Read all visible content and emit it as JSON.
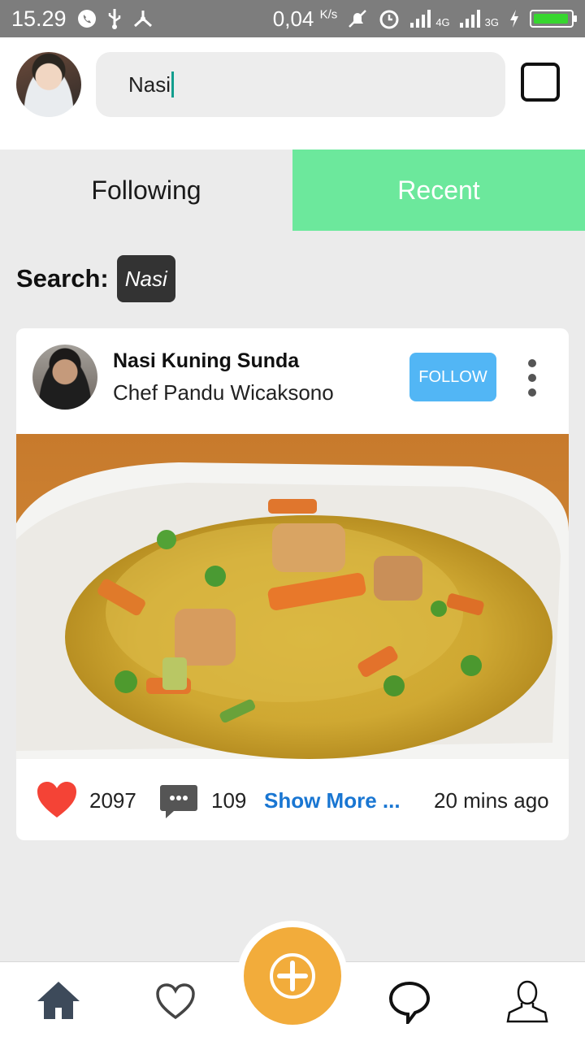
{
  "status_bar": {
    "time": "15.29",
    "speed": "0,04",
    "speed_unit": "K/s",
    "net1": "4G",
    "net2": "3G"
  },
  "header": {
    "search_value": "Nasi"
  },
  "tabs": [
    {
      "label": "Following",
      "active": false
    },
    {
      "label": "Recent",
      "active": true
    }
  ],
  "search": {
    "label": "Search:",
    "query_chip": "Nasi"
  },
  "post": {
    "title": "Nasi Kuning Sunda",
    "author": "Chef Pandu Wicaksono",
    "follow_label": "FOLLOW",
    "likes": "2097",
    "comments": "109",
    "show_more": "Show More ...",
    "time_ago": "20 mins ago"
  },
  "colors": {
    "accent_green": "#6ce89c",
    "follow_blue": "#52b6f5",
    "fab_orange": "#f2ac3b",
    "heart_red": "#f44336",
    "link_blue": "#1976d2"
  },
  "icons": [
    "whatsapp-icon",
    "usb-icon",
    "share-icon",
    "mute-icon",
    "alarm-icon",
    "signal-icon",
    "battery-icon",
    "search-input",
    "heart-icon",
    "comment-icon",
    "home-icon",
    "heart-outline-icon",
    "plus-icon",
    "chat-icon",
    "user-icon",
    "more-icon"
  ]
}
